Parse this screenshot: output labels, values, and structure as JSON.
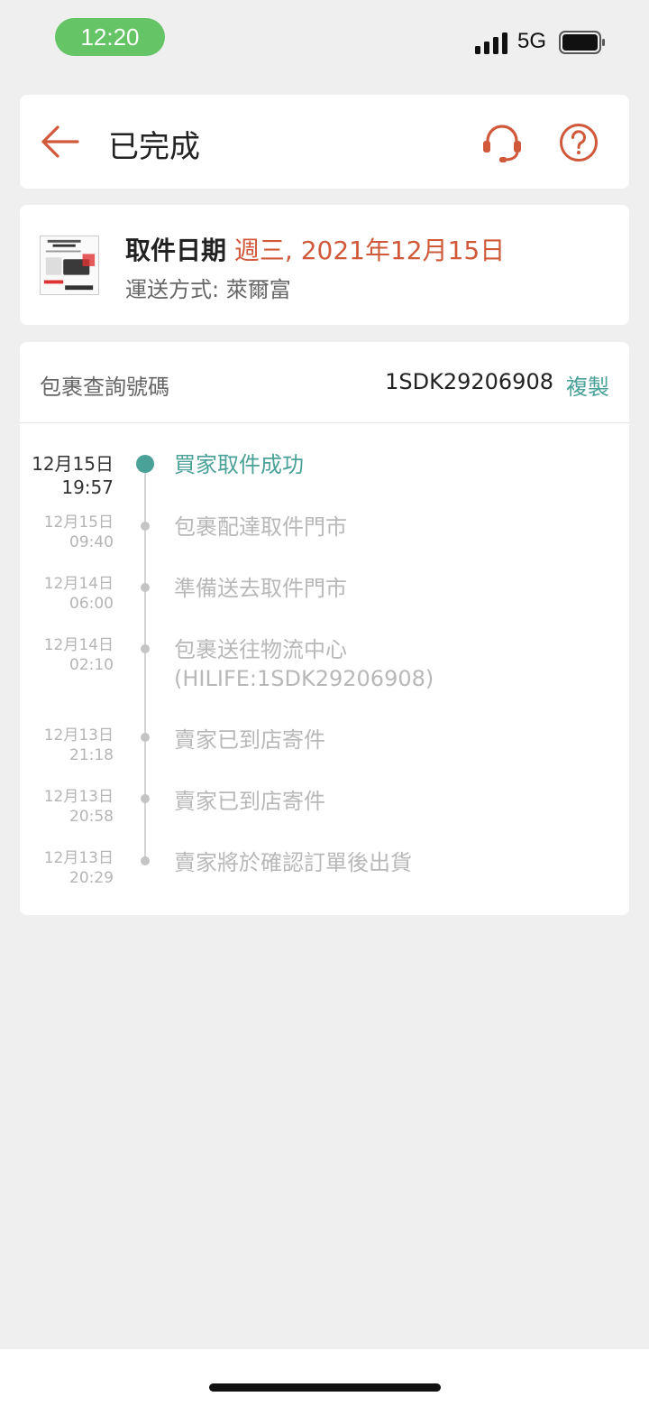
{
  "status_bar": {
    "time": "12:20",
    "network": "5G"
  },
  "header": {
    "title": "已完成"
  },
  "pickup": {
    "date_label": "取件日期",
    "date_value": "週三, 2021年12月15日",
    "shipping_line": "運送方式: 萊爾富"
  },
  "tracking": {
    "label": "包裹查詢號碼",
    "number": "1SDK29206908",
    "copy_label": "複製",
    "events": [
      {
        "date": "12月15日",
        "time": "19:57",
        "text": "買家取件成功"
      },
      {
        "date": "12月15日",
        "time": "09:40",
        "text": "包裹配達取件門市"
      },
      {
        "date": "12月14日",
        "time": "06:00",
        "text": "準備送去取件門市"
      },
      {
        "date": "12月14日",
        "time": "02:10",
        "text": "包裹送往物流中心",
        "text2": "(HILIFE:1SDK29206908)"
      },
      {
        "date": "12月13日",
        "time": "21:18",
        "text": "賣家已到店寄件"
      },
      {
        "date": "12月13日",
        "time": "20:58",
        "text": "賣家已到店寄件"
      },
      {
        "date": "12月13日",
        "time": "20:29",
        "text": "賣家將於確認訂單後出貨"
      }
    ]
  },
  "colors": {
    "accent": "#d0593a",
    "teal": "#4aa197",
    "status_pill": "#65c466"
  },
  "icons": [
    "signal-icon",
    "battery-icon",
    "back-arrow-icon",
    "support-headset-icon",
    "help-icon",
    "product-thumbnail"
  ]
}
